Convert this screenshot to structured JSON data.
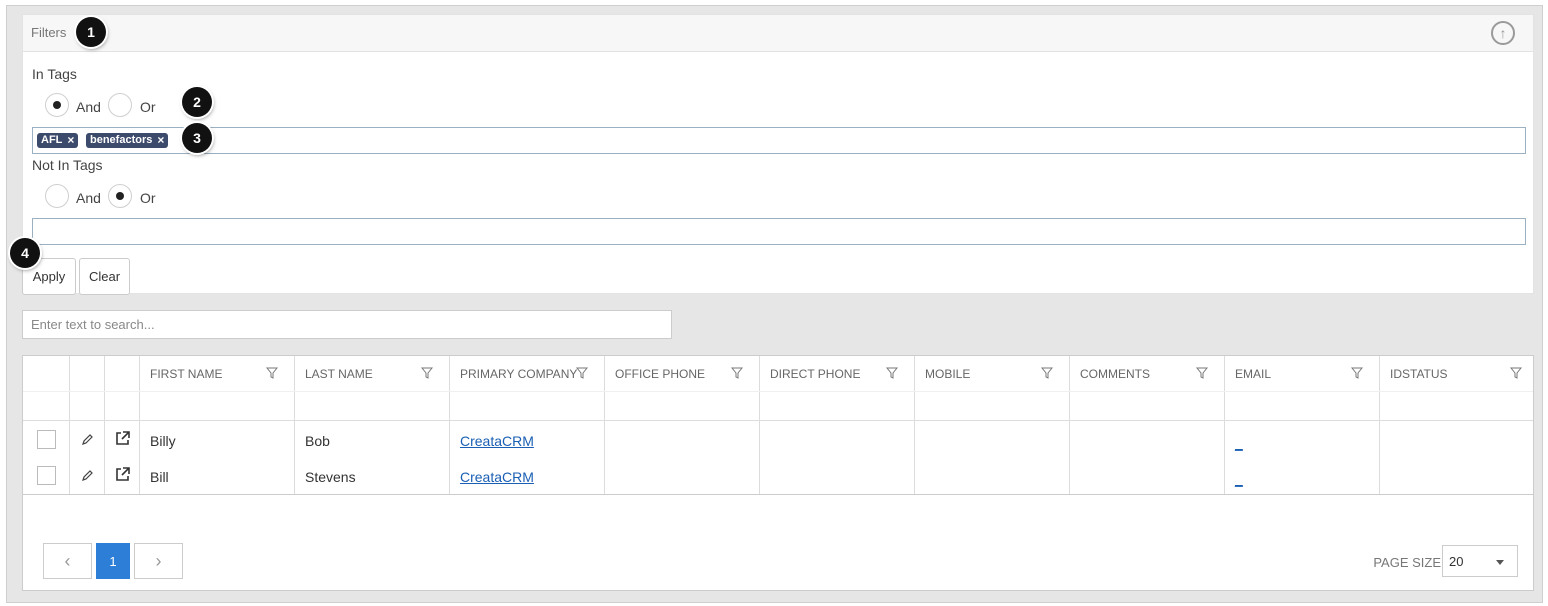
{
  "filters": {
    "title": "Filters",
    "in_tags": {
      "label": "In Tags",
      "and_label": "And",
      "or_label": "Or",
      "selected": "And",
      "tags": [
        "AFL",
        "benefactors"
      ]
    },
    "not_in_tags": {
      "label": "Not In Tags",
      "and_label": "And",
      "or_label": "Or",
      "selected": "Or",
      "tags": []
    },
    "apply_label": "Apply",
    "clear_label": "Clear"
  },
  "callouts": [
    "1",
    "2",
    "3",
    "4"
  ],
  "search": {
    "placeholder": "Enter text to search..."
  },
  "table": {
    "columns": [
      "FIRST NAME",
      "LAST NAME",
      "PRIMARY COMPANY",
      "OFFICE PHONE",
      "DIRECT PHONE",
      "MOBILE",
      "COMMENTS",
      "EMAIL",
      "IDSTATUS"
    ],
    "rows": [
      {
        "first_name": "Billy",
        "last_name": "Bob",
        "primary_company": "CreataCRM",
        "email": "_"
      },
      {
        "first_name": "Bill",
        "last_name": "Stevens",
        "primary_company": "CreataCRM",
        "email": "_"
      }
    ]
  },
  "pager": {
    "prev": "‹",
    "current_page": "1",
    "next": "›",
    "page_size_label": "PAGE SIZE",
    "page_size": "20"
  },
  "icons": {
    "collapse": "arrow-up-circle-icon",
    "edit": "pencil-icon",
    "open": "external-link-icon",
    "filter": "funnel-icon",
    "tag_remove": "close-icon"
  }
}
